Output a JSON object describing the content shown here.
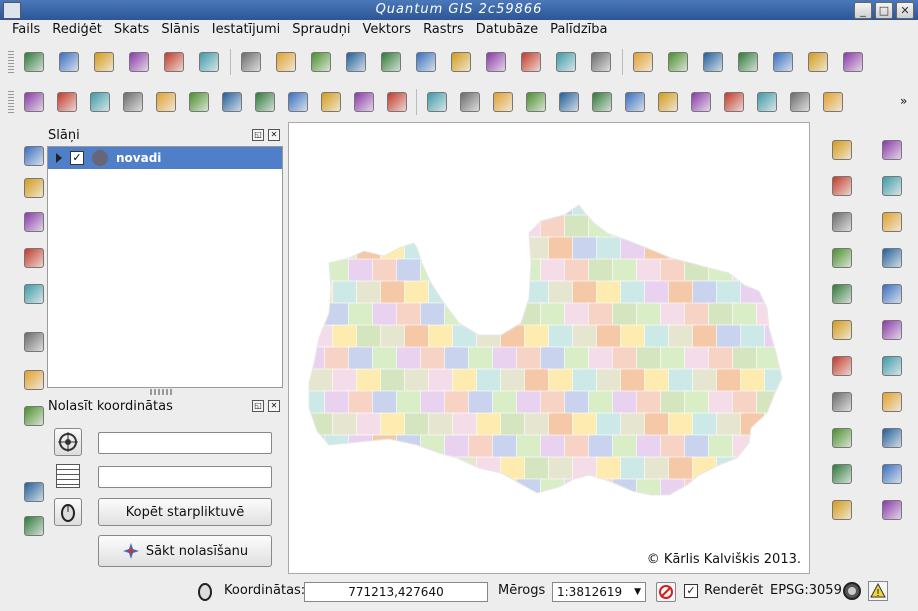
{
  "window": {
    "title": "Quantum GIS 2c59866",
    "minimize": "_",
    "maximize": "□",
    "close": "✕"
  },
  "menu": [
    "Fails",
    "Rediģēt",
    "Skats",
    "Slānis",
    "Iestatījumi",
    "Spraudņi",
    "Vektors",
    "Rastrs",
    "Datubāze",
    "Palīdzība"
  ],
  "toolbar1_icons": [
    "new-project-icon",
    "open-project-icon",
    "save-project-icon",
    "save-as-icon",
    "new-print-composer-icon",
    "print-icon",
    "add-vector-layer-icon",
    "add-raster-layer-icon",
    "add-postgis-layer-icon",
    "add-spatialite-layer-icon",
    "add-mssql-layer-icon",
    "add-wms-layer-icon",
    "add-wcs-layer-icon",
    "add-wfs-layer-icon",
    "add-delimited-text-icon",
    "remove-layer-icon",
    "new-shapefile-icon",
    "label-icon",
    "label-pin-icon",
    "label-tag-icon",
    "label-show-icon",
    "label-move-icon",
    "label-rotate-icon",
    "label-change-icon"
  ],
  "toolbar2_icons": [
    "current-edits-icon",
    "toggle-editing-icon",
    "save-edits-icon",
    "add-feature-icon",
    "move-feature-icon",
    "node-tool-icon",
    "delete-selected-icon",
    "cut-features-icon",
    "copy-features-icon",
    "paste-features-icon",
    "split-features-icon",
    "split-parts-icon",
    "undo-icon",
    "redo-icon",
    "simplify-feature-icon",
    "add-ring-icon",
    "add-part-icon",
    "delete-ring-icon",
    "delete-part-icon",
    "reshape-icon",
    "offset-curve-icon",
    "split-parts-2-icon",
    "merge-features-icon",
    "merge-attributes-icon",
    "rotate-symbols-icon"
  ],
  "toolbar2_more": "»",
  "left_toolbar_icons": [
    "histogram-icon",
    "stretch-icon",
    "histogram-2-icon",
    "stretch-2-icon",
    "georeferencer-icon",
    "measure-compass-icon",
    "gps-icon",
    "grid-plugin-icon",
    "help-book-icon",
    "whats-this-icon"
  ],
  "layers_panel": {
    "title": "Slāņi",
    "layers": [
      {
        "name": "novadi",
        "checked": "✓"
      }
    ]
  },
  "coord_panel": {
    "title": "Nolasīt koordinātas",
    "field1_value": "",
    "field2_value": "",
    "copy_button": "Kopēt starpliktuvē",
    "start_button": "Sākt nolasīšanu"
  },
  "map": {
    "copyright": "© Kārlis Kalviškis 2013."
  },
  "right_toolbar_icons": [
    "identify-icon",
    "pan-icon",
    "settings-icon",
    "pan-to-selection-icon",
    "select-feature-icon",
    "zoom-in-icon",
    "deselect-icon",
    "zoom-out-icon",
    "attribute-table-icon",
    "zoom-full-icon",
    "measure-line-icon",
    "zoom-to-layer-icon",
    "map-tips-icon",
    "zoom-to-selection-icon",
    "new-bookmark-icon",
    "zoom-last-icon",
    "show-bookmarks-icon",
    "zoom-next-icon",
    "text-annotation-icon",
    "zoom-native-icon",
    "db-icon",
    "globe-icon"
  ],
  "status": {
    "coords_label": "Koordinātas:",
    "coords_value": "771213,427640",
    "scale_label": "Mērogs",
    "scale_value": "1:3812619",
    "render_label": "Renderēt",
    "render_checked": "✓",
    "epsg": "EPSG:3059",
    "warning": "!"
  },
  "colors": {
    "title_bar": "#2c5696",
    "selection": "#4f7fc8"
  }
}
